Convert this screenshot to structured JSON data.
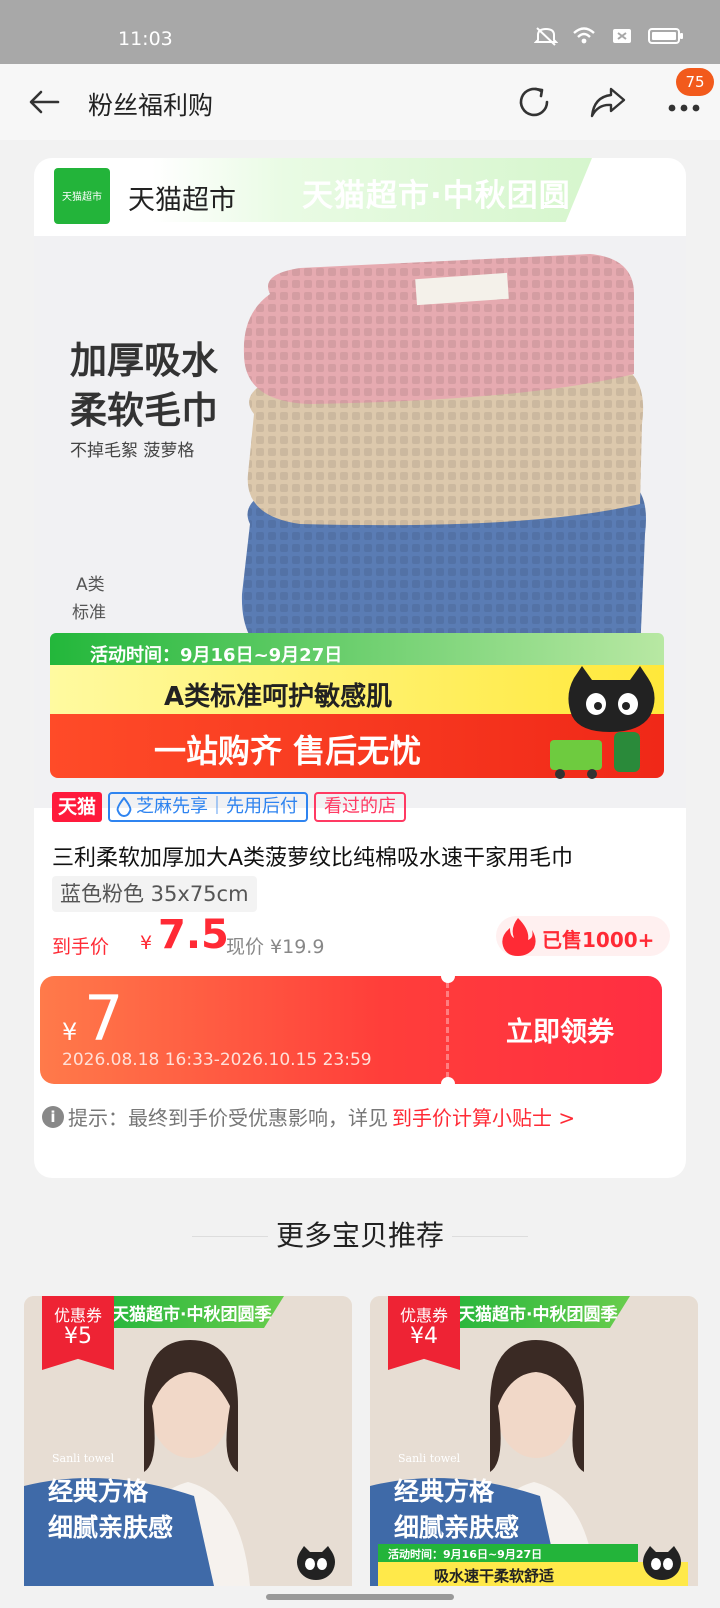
{
  "status_bar": {
    "time": "11:03"
  },
  "nav": {
    "title": "粉丝福利购",
    "badge": "75"
  },
  "shop": {
    "logo_text": "天猫超市",
    "name": "天猫超市",
    "banner": "天猫超市·中秋团圆季"
  },
  "hero": {
    "slogan_1": "加厚吸水",
    "slogan_2": "柔软毛巾",
    "slogan_sub": "不掉毛絮 菠萝格",
    "grade_1": "A类",
    "grade_2": "标准",
    "activity": "活动时间：9月16日~9月27日",
    "yellow": "A类标准呵护敏感肌",
    "red": "一站购齐 售后无忧",
    "towel_colors": [
      "#e6aab0",
      "#dcc8ac",
      "#5a7cb4"
    ]
  },
  "tags": {
    "tmall": "天猫",
    "credit": "芝麻先享｜先用后付",
    "seen": "看过的店"
  },
  "product": {
    "title": "三利柔软加厚加大A类菠萝纹比纯棉吸水速干家用毛巾",
    "variant": "蓝色粉色 35x75cm",
    "price_label": "到手价",
    "price_yen": "¥",
    "price": "7.5",
    "price_now": "现价 ¥19.9",
    "sold": "已售1000+"
  },
  "coupon": {
    "yen": "¥",
    "amount": "7",
    "period": "2026.08.18 16:33-2026.10.15 23:59",
    "claim": "立即领券"
  },
  "tip": {
    "icon": "i",
    "text": "提示：最终到手价受优惠影响，详见",
    "link": "到手价计算小贴士 >"
  },
  "more": {
    "title": "更多宝贝推荐"
  },
  "recommendations": [
    {
      "banner": "天猫超市·中秋团圆季",
      "coupon_label": "优惠券",
      "coupon_value": "¥5",
      "brand": "Sanli towel",
      "line1": "经典方格",
      "line2": "细腻亲肤感"
    },
    {
      "banner": "天猫超市·中秋团圆季",
      "coupon_label": "优惠券",
      "coupon_value": "¥4",
      "brand": "Sanli towel",
      "line1": "经典方格",
      "line2": "细腻亲肤感",
      "activity": "活动时间：9月16日~9月27日",
      "yellow": "吸水速干柔软舒适"
    }
  ]
}
